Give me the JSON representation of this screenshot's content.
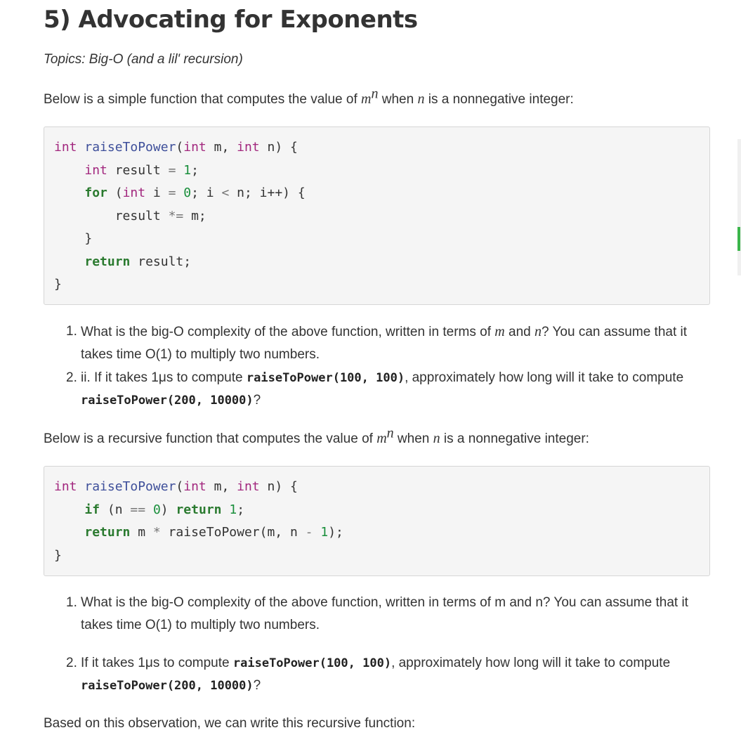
{
  "heading": "5) Advocating for Exponents",
  "topics": "Topics: Big-O (and a lil' recursion)",
  "intro1": {
    "before": "Below is a simple function that computes the value of ",
    "base": "m",
    "exp": "n",
    "middle": " when ",
    "var": "n",
    "after": " is a nonnegative integer:"
  },
  "code1": {
    "l1_int": "int",
    "l1_name": "raiseToPower",
    "l1_p1": "(",
    "l1_int2": "int",
    "l1_p2": " m, ",
    "l1_int3": "int",
    "l1_p3": " n) {",
    "l2_int": "int",
    "l2_rest": " result ",
    "l2_eq": "=",
    "l2_num": "1",
    "l2_semi": ";",
    "l3_for": "for",
    "l3_p1": " (",
    "l3_int": "int",
    "l3_p2": " i ",
    "l3_eq": "=",
    "l3_num": "0",
    "l3_p3": "; i ",
    "l3_lt": "<",
    "l3_p4": " n; i++) {",
    "l4_a": "result ",
    "l4_op": "*=",
    "l4_b": " m;",
    "l5": "}",
    "l6_ret": "return",
    "l6_rest": " result;",
    "l7": "}"
  },
  "q1": {
    "item1_marker": "1.",
    "item1_a": "What is the big-O complexity of the above function, written in terms of ",
    "item1_m": "m",
    "item1_b": " and ",
    "item1_n": "n",
    "item1_c": "? You can assume that it takes time O(1) to multiply two numbers.",
    "item2_marker": "2.",
    "item2_a": "ii. If it takes 1μs to compute ",
    "item2_code1": "raiseToPower(100, 100)",
    "item2_b": ", approximately how long will it take to compute ",
    "item2_code2": "raiseToPower(200, 10000)",
    "item2_c": "?"
  },
  "intro2": {
    "before": "Below is a recursive function that computes the value of ",
    "base": "m",
    "exp": "n",
    "middle": " when ",
    "var": "n",
    "after": " is a nonnegative integer:"
  },
  "code2": {
    "l1_int": "int",
    "l1_name": "raiseToPower",
    "l1_p1": "(",
    "l1_int2": "int",
    "l1_p2": " m, ",
    "l1_int3": "int",
    "l1_p3": " n) {",
    "l2_if": "if",
    "l2_p1": " (n ",
    "l2_eq": "==",
    "l2_sp": " ",
    "l2_num": "0",
    "l2_p2": ") ",
    "l2_ret": "return",
    "l2_sp2": " ",
    "l2_num2": "1",
    "l2_semi": ";",
    "l3_ret": "return",
    "l3_p1": " m ",
    "l3_op": "*",
    "l3_p2": " raiseToPower(m, n ",
    "l3_minus": "-",
    "l3_sp": " ",
    "l3_num": "1",
    "l3_p3": ");",
    "l4": "}"
  },
  "q2": {
    "item1_marker": "1.",
    "item1": "What is the big-O complexity of the above function, written in terms of m and n? You can assume that it takes time O(1) to multiply two numbers.",
    "item2_marker": "2.",
    "item2_a": "If it takes 1μs to compute ",
    "item2_code1": "raiseToPower(100, 100)",
    "item2_b": ", approximately how long will it take to compute ",
    "item2_code2": "raiseToPower(200, 10000)",
    "item2_c": "?"
  },
  "outro": "Based on this observation, we can write this recursive function:",
  "colors": {
    "keyword_type": "#a2277e",
    "function_name": "#3e4f9a",
    "number": "#1a8f3c",
    "keyword": "#2a7a2f",
    "scroll_indicator": "#3ab54a"
  }
}
